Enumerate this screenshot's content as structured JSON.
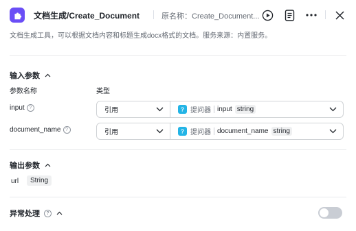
{
  "header": {
    "title": "文档生成/Create_Document",
    "origin_name": "原名称：Create_Document...",
    "icons": [
      "puzzle-icon",
      "play-icon",
      "document-list-icon",
      "more-icon",
      "close-icon"
    ]
  },
  "description": "文档生成工具，可以根据文档内容和标题生成docx格式的文档。服务来源：内置服务。",
  "input_section": {
    "title": "输入参数",
    "col_name": "参数名称",
    "col_type": "类型",
    "rows": [
      {
        "name": "input",
        "mode": "引用",
        "source": "提问器",
        "var": "input",
        "type": "string"
      },
      {
        "name": "document_name",
        "mode": "引用",
        "source": "提问器",
        "var": "document_name",
        "type": "string"
      }
    ]
  },
  "output_section": {
    "title": "输出参数",
    "name": "url",
    "type": "String"
  },
  "exception_section": {
    "title": "异常处理",
    "enabled": false
  },
  "colors": {
    "accent": "#6a4ef6",
    "var_icon": "#23b4e6",
    "toggle_off": "#c9cdd4"
  }
}
